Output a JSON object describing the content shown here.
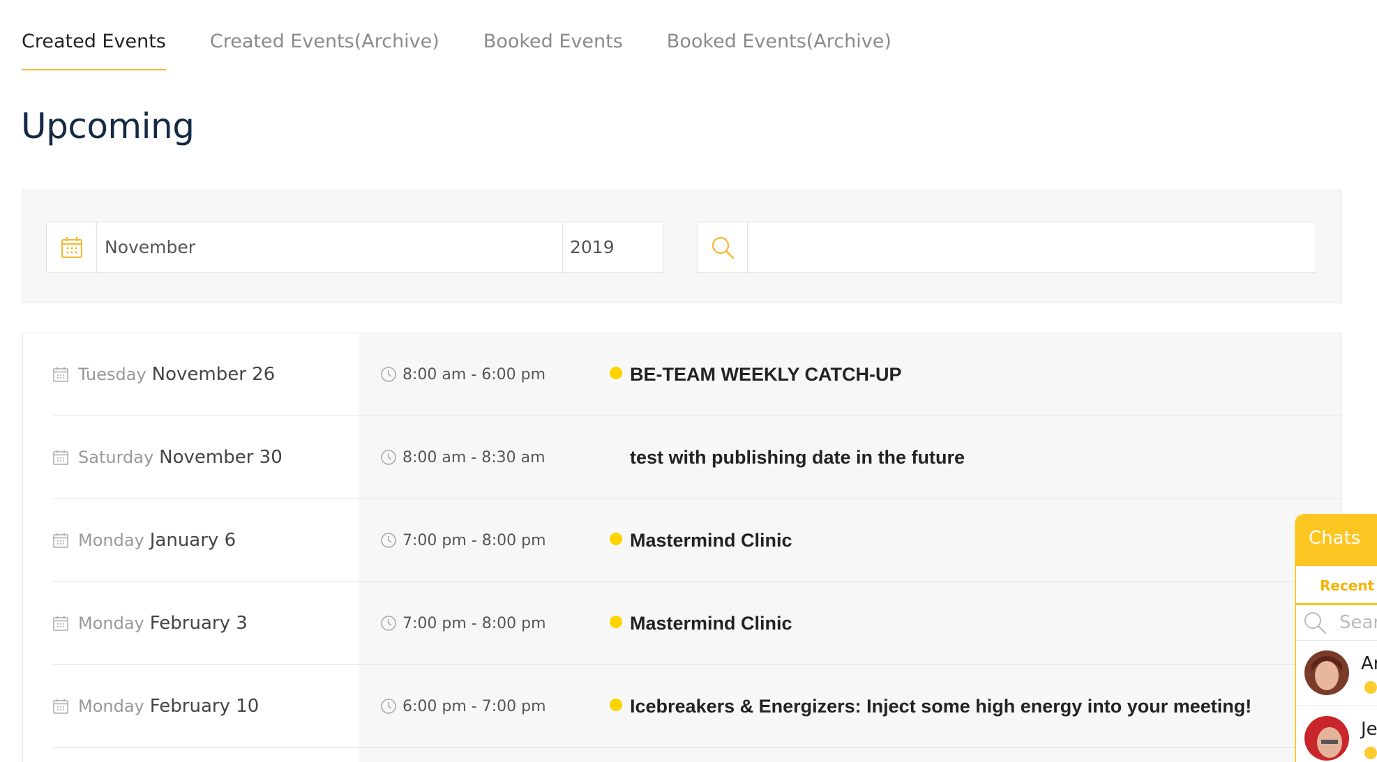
{
  "tabs": [
    {
      "label": "Created Events",
      "active": true
    },
    {
      "label": "Created Events(Archive)",
      "active": false
    },
    {
      "label": "Booked Events",
      "active": false
    },
    {
      "label": "Booked Events(Archive)",
      "active": false
    }
  ],
  "page_title": "Upcoming",
  "filter": {
    "calendar_icon": "calendar-icon",
    "month": "November",
    "year": "2019",
    "search_icon": "search-icon",
    "search_value": ""
  },
  "events": [
    {
      "weekday": "Tuesday",
      "date": "November 26",
      "time": "8:00 am - 6:00 pm",
      "title": "BE-TEAM WEEKLY CATCH-UP",
      "has_dot": true
    },
    {
      "weekday": "Saturday",
      "date": "November 30",
      "time": "8:00 am - 8:30 am",
      "title": "test with publishing date in the future",
      "has_dot": false
    },
    {
      "weekday": "Monday",
      "date": "January 6",
      "time": "7:00 pm - 8:00 pm",
      "title": "Mastermind Clinic",
      "has_dot": true
    },
    {
      "weekday": "Monday",
      "date": "February 3",
      "time": "7:00 pm - 8:00 pm",
      "title": "Mastermind Clinic",
      "has_dot": true
    },
    {
      "weekday": "Monday",
      "date": "February 10",
      "time": "6:00 pm - 7:00 pm",
      "title": "Icebreakers & Energizers: Inject some high energy into your meeting!",
      "has_dot": true
    }
  ],
  "chat": {
    "header": "Chats",
    "tab_label": "Recent",
    "search_placeholder": "Sear",
    "contacts": [
      {
        "name": "Ar"
      },
      {
        "name": "Je"
      }
    ]
  },
  "colors": {
    "accent": "#f5b82e",
    "event_dot": "#fed400",
    "title": "#142a44",
    "chat_header": "#fcc521"
  }
}
